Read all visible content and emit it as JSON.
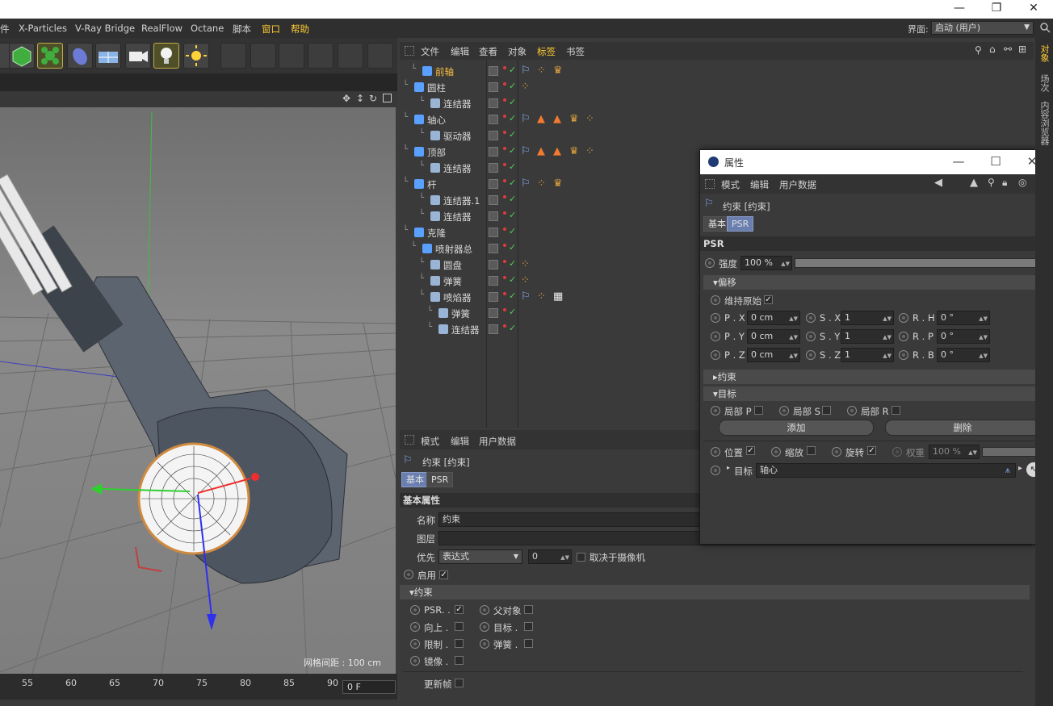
{
  "window": {
    "controls": {
      "minimize": "—",
      "restore": "❐",
      "close": "✕"
    }
  },
  "menubar": {
    "items": [
      "件",
      "X-Particles",
      "V-Ray Bridge",
      "RealFlow",
      "Octane",
      "脚本",
      "窗口",
      "帮助"
    ],
    "highlighted": [
      "窗口",
      "帮助"
    ],
    "layout_label": "界面:",
    "layout_value": "启动 (用户)"
  },
  "viewport": {
    "grid_label": "网格间距 : 100 cm"
  },
  "timeline": {
    "ticks": [
      "55",
      "60",
      "65",
      "70",
      "75",
      "80",
      "85",
      "90"
    ],
    "frame": "0 F"
  },
  "object_manager": {
    "menu": [
      "文件",
      "编辑",
      "查看",
      "对象",
      "标签",
      "书签"
    ],
    "active_menu": "标签",
    "rows": [
      {
        "name": "前轴",
        "selected": true,
        "indent": 1,
        "tags": [
          "constraint",
          "dots",
          "crown"
        ]
      },
      {
        "name": "圆柱",
        "selected": false,
        "indent": 0,
        "tags": [
          "dots"
        ]
      },
      {
        "name": "连结器",
        "selected": false,
        "indent": 2,
        "tags": []
      },
      {
        "name": "轴心",
        "selected": false,
        "indent": 0,
        "tags": [
          "constraint",
          "cone",
          "cone",
          "crown",
          "dots"
        ]
      },
      {
        "name": "驱动器",
        "selected": false,
        "indent": 2,
        "tags": []
      },
      {
        "name": "顶部",
        "selected": false,
        "indent": 0,
        "tags": [
          "constraint",
          "cone",
          "cone",
          "crown",
          "dots"
        ]
      },
      {
        "name": "连结器",
        "selected": false,
        "indent": 2,
        "tags": []
      },
      {
        "name": "杆",
        "selected": false,
        "indent": 0,
        "tags": [
          "constraint",
          "dots",
          "crown"
        ]
      },
      {
        "name": "连结器.1",
        "selected": false,
        "indent": 2,
        "tags": []
      },
      {
        "name": "连结器",
        "selected": false,
        "indent": 2,
        "tags": []
      },
      {
        "name": "克隆",
        "selected": false,
        "indent": 0,
        "tags": []
      },
      {
        "name": "喷射器总",
        "selected": false,
        "indent": 1,
        "tags": []
      },
      {
        "name": "圆盘",
        "selected": false,
        "indent": 2,
        "tags": [
          "dots"
        ]
      },
      {
        "name": "弹簧",
        "selected": false,
        "indent": 2,
        "tags": [
          "dots"
        ]
      },
      {
        "name": "喷焰器",
        "selected": false,
        "indent": 2,
        "tags": [
          "constraint",
          "dots",
          "checker"
        ]
      },
      {
        "name": "弹簧",
        "selected": false,
        "indent": 3,
        "tags": []
      },
      {
        "name": "连结器",
        "selected": false,
        "indent": 3,
        "tags": []
      }
    ]
  },
  "attributes_bottom": {
    "menu": [
      "模式",
      "编辑",
      "用户数据"
    ],
    "object_title": "约束 [约束]",
    "tabs": [
      "基本",
      "PSR"
    ],
    "active_tab": "基本",
    "section": "基本属性",
    "name_label": "名称",
    "name_value": "约束",
    "layer_label": "图层",
    "priority_label": "优先",
    "priority_value": "表达式",
    "priority_number": "0",
    "camera_label": "取决于摄像机",
    "enable_label": "启用",
    "constraint_section": "约束",
    "options": [
      {
        "label": "PSR. .",
        "checked": true
      },
      {
        "label": "父对象",
        "checked": false
      },
      {
        "label": "向上 .",
        "checked": false
      },
      {
        "label": "目标 .",
        "checked": false
      },
      {
        "label": "限制 .",
        "checked": false
      },
      {
        "label": "弹簧 .",
        "checked": false
      },
      {
        "label": "镜像 .",
        "checked": false
      }
    ],
    "update_frame": "更新帧"
  },
  "attributes_window": {
    "title": "属性",
    "menu": [
      "模式",
      "编辑",
      "用户数据"
    ],
    "object_title": "约束 [约束]",
    "tabs": [
      "基本",
      "PSR"
    ],
    "active_tab": "PSR",
    "section": "PSR",
    "strength_label": "强度",
    "strength_value": "100 %",
    "offset_section": "偏移",
    "keep_original": "维持原始",
    "px_label": "P . X",
    "px": "0 cm",
    "py_label": "P . Y",
    "py": "0 cm",
    "pz_label": "P . Z",
    "pz": "0 cm",
    "sx_label": "S . X",
    "sx": "1",
    "sy_label": "S . Y",
    "sy": "1",
    "sz_label": "S . Z",
    "sz": "1",
    "rh_label": "R . H",
    "rh": "0 °",
    "rp_label": "R . P",
    "rp": "0 °",
    "rb_label": "R . B",
    "rb": "0 °",
    "constraint_section": "约束",
    "target_section": "目标",
    "local_p": "局部 P",
    "local_s": "局部 S",
    "local_r": "局部 R",
    "add_button": "添加",
    "delete_button": "删除",
    "position_label": "位置",
    "scale_label": "缩放",
    "rotation_label": "旋转",
    "weight_label": "权重",
    "weight_value": "100 %",
    "target_label": "目标",
    "target_value": "轴心"
  },
  "right_panel": {
    "tabs": [
      "对象",
      "场次",
      "内容浏览器"
    ]
  },
  "colors": {
    "accent": "#ffcc33",
    "tab_active": "#6a7fb0",
    "check_green": "#52d152"
  }
}
